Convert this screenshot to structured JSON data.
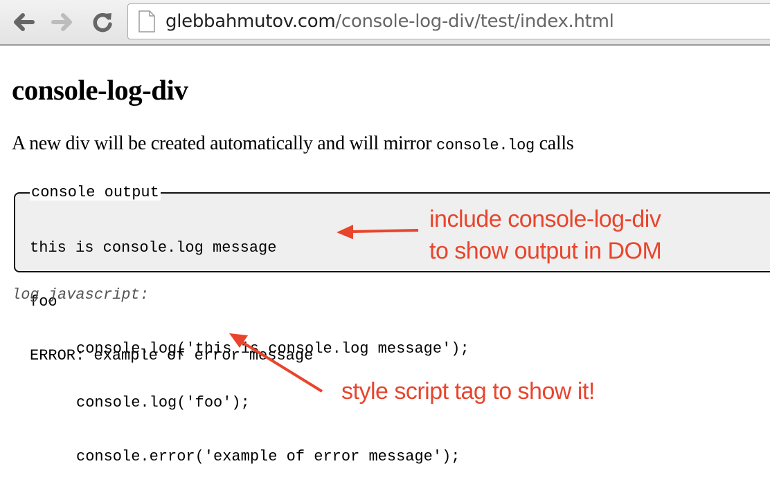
{
  "browser": {
    "back_icon": "arrow-left-icon",
    "forward_icon": "arrow-right-icon",
    "reload_icon": "reload-icon",
    "page_icon": "document-icon",
    "url_host": "glebbahmutov.com",
    "url_path": "/console-log-div/test/index.html"
  },
  "page": {
    "title": "console-log-div",
    "intro_prefix": "A new div will be created automatically and will mirror ",
    "intro_code": "console.log",
    "intro_suffix": " calls",
    "console_box": {
      "legend": "console output",
      "lines": [
        "this is console.log message",
        "foo",
        "ERROR: example of error message"
      ]
    },
    "log_label": "log javascript:",
    "code_lines": [
      "console.log('this is console.log message');",
      "console.log('foo');",
      "console.error('example of error message');"
    ]
  },
  "annotations": {
    "color": "#e8452c",
    "note_1_line_1": "include console-log-div",
    "note_1_line_2": "to show output in DOM",
    "note_2": "style script tag to show it!"
  }
}
